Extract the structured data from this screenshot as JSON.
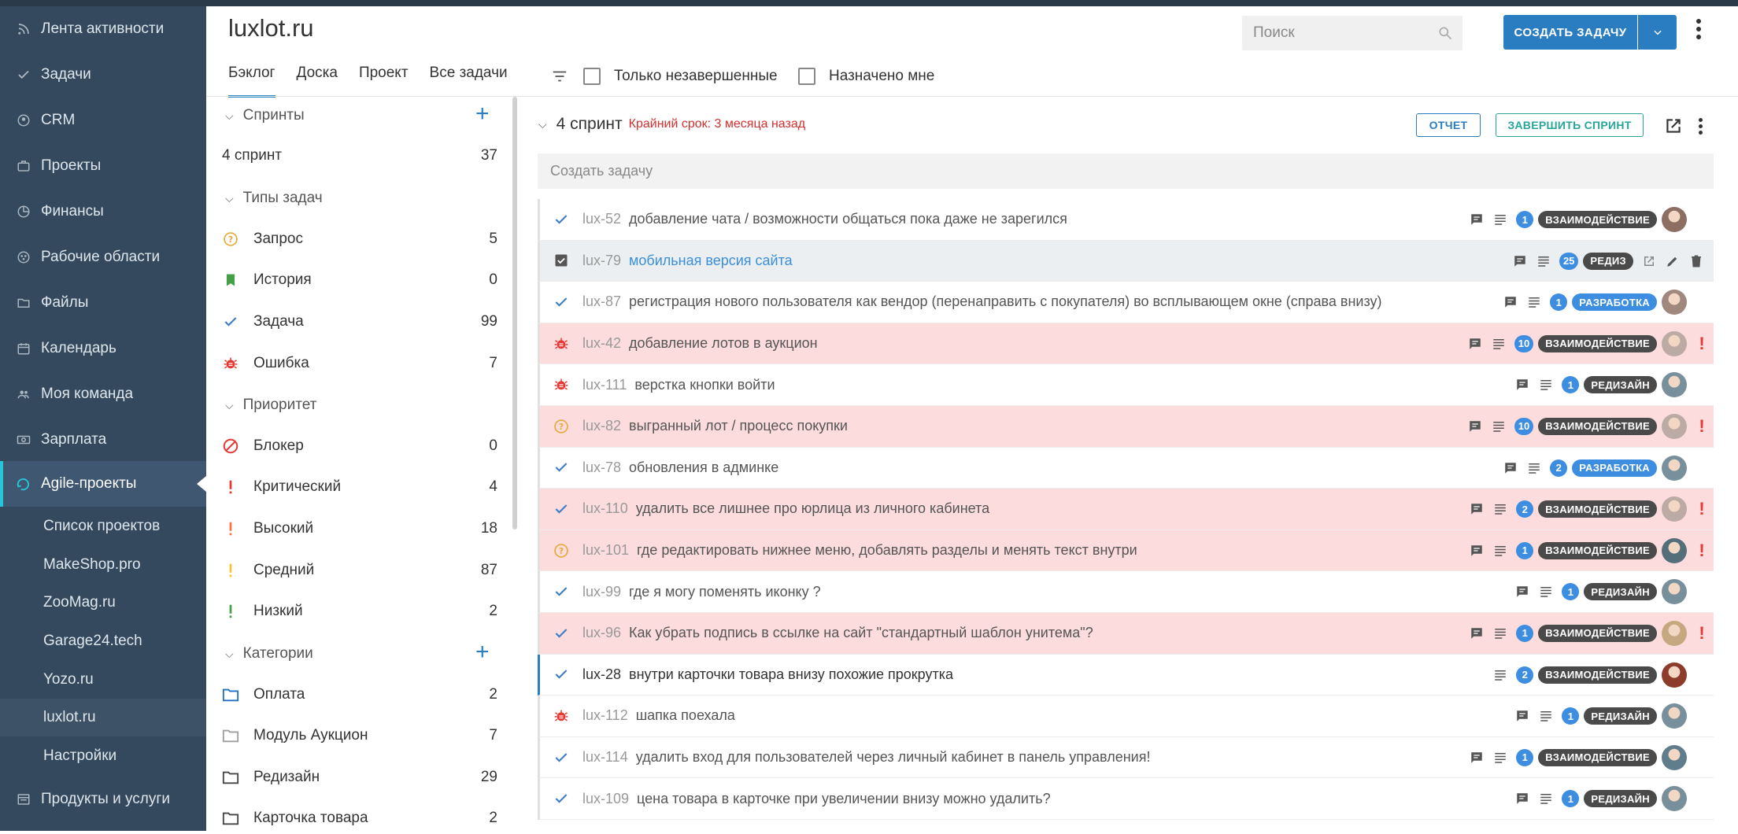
{
  "sidebar": {
    "items": [
      {
        "label": "Лента активности",
        "icon": "rss-icon"
      },
      {
        "label": "Задачи",
        "icon": "check-icon"
      },
      {
        "label": "CRM",
        "icon": "person-circle-icon"
      },
      {
        "label": "Проекты",
        "icon": "briefcase-icon"
      },
      {
        "label": "Финансы",
        "icon": "pie-chart-icon"
      },
      {
        "label": "Рабочие области",
        "icon": "workspace-icon"
      },
      {
        "label": "Файлы",
        "icon": "folder-icon"
      },
      {
        "label": "Календарь",
        "icon": "calendar-icon"
      },
      {
        "label": "Моя команда",
        "icon": "team-icon"
      },
      {
        "label": "Зарплата",
        "icon": "money-icon"
      },
      {
        "label": "Agile-проекты",
        "icon": "agile-icon"
      }
    ],
    "subitems": [
      "Список проектов",
      "MakeShop.pro",
      "ZooMag.ru",
      "Garage24.tech",
      "Yozo.ru",
      "luxlot.ru",
      "Настройки"
    ],
    "bottom": {
      "label": "Продукты и услуги",
      "icon": "products-icon"
    }
  },
  "header": {
    "title": "luxlot.ru",
    "tabs": [
      "Бэклог",
      "Доска",
      "Проект",
      "Все задачи"
    ],
    "filter_unfinished": "Только незавершенные",
    "filter_assigned": "Назначено мне",
    "search_placeholder": "Поиск",
    "create_button": "СОЗДАТЬ ЗАДАЧУ"
  },
  "filters": {
    "sprints_title": "Спринты",
    "sprint_item": {
      "label": "4 спринт",
      "count": "37"
    },
    "types_title": "Типы задач",
    "types": [
      {
        "label": "Запрос",
        "count": "5",
        "icon": "question-icon"
      },
      {
        "label": "История",
        "count": "0",
        "icon": "bookmark-icon"
      },
      {
        "label": "Задача",
        "count": "99",
        "icon": "check-icon"
      },
      {
        "label": "Ошибка",
        "count": "7",
        "icon": "bug-icon"
      }
    ],
    "priority_title": "Приоритет",
    "priorities": [
      {
        "label": "Блокер",
        "count": "0",
        "icon": "blocker-icon"
      },
      {
        "label": "Критический",
        "count": "4",
        "icon": "exclamation-red-icon"
      },
      {
        "label": "Высокий",
        "count": "18",
        "icon": "exclamation-orange-icon"
      },
      {
        "label": "Средний",
        "count": "87",
        "icon": "exclamation-yellow-icon"
      },
      {
        "label": "Низкий",
        "count": "2",
        "icon": "exclamation-green-icon"
      }
    ],
    "categories_title": "Категории",
    "categories": [
      {
        "label": "Оплата",
        "count": "2",
        "color": "#1e6fc2"
      },
      {
        "label": "Модуль Аукцион",
        "count": "7",
        "color": "#9e9e9e"
      },
      {
        "label": "Редизайн",
        "count": "29",
        "color": "#444444"
      },
      {
        "label": "Карточка товара",
        "count": "2",
        "color": "#444444"
      }
    ]
  },
  "sprint": {
    "name": "4 спринт",
    "deadline": "Крайний срок: 3 месяца назад",
    "report_button": "ОТЧЕТ",
    "finish_button": "ЗАВЕРШИТЬ СПРИНТ",
    "create_placeholder": "Создать задачу"
  },
  "tasks": [
    {
      "key": "lux-52",
      "title": "добавление чата / возможности общаться пока даже не зарегился",
      "type": "task",
      "bg": "normal",
      "comment": true,
      "count": "1",
      "tag": "ВЗАИМОДЕЙСТВИЕ",
      "tag_style": "dark",
      "avatar": "#8d6e63",
      "flag": false
    },
    {
      "key": "lux-79",
      "title": "мобильная версия сайта",
      "type": "checkbox",
      "bg": "selected",
      "comment": true,
      "count": "25",
      "tag": "РЕДИЗ",
      "tag_style": "dark",
      "avatar": "",
      "flag": false,
      "actions": true
    },
    {
      "key": "lux-87",
      "title": "регистрация нового пользователя как вендор (перенаправить с покупателя) во всплывающем окне (справа внизу)",
      "type": "task",
      "bg": "normal",
      "comment": true,
      "count": "1",
      "tag": "РАЗРАБОТКА",
      "tag_style": "blue",
      "avatar": "#a1887f",
      "flag": false
    },
    {
      "key": "lux-42",
      "title": "добавление лотов в аукцион",
      "type": "bug",
      "bg": "red",
      "comment": true,
      "count": "10",
      "tag": "ВЗАИМОДЕЙСТВИЕ",
      "tag_style": "dark",
      "avatar": "#bcaaa4",
      "flag": true
    },
    {
      "key": "lux-111",
      "title": "верстка кнопки войти",
      "type": "bug",
      "bg": "normal",
      "comment": true,
      "count": "1",
      "tag": "РЕДИЗАЙН",
      "tag_style": "dark",
      "avatar": "#78909c",
      "flag": false
    },
    {
      "key": "lux-82",
      "title": "выгранный лот / процесс покупки",
      "type": "question",
      "bg": "red",
      "comment": true,
      "count": "10",
      "tag": "ВЗАИМОДЕЙСТВИЕ",
      "tag_style": "dark",
      "avatar": "#bcaaa4",
      "flag": true
    },
    {
      "key": "lux-78",
      "title": "обновления в админке",
      "type": "task",
      "bg": "normal",
      "comment": true,
      "count": "2",
      "tag": "РАЗРАБОТКА",
      "tag_style": "blue",
      "avatar": "#78909c",
      "flag": false
    },
    {
      "key": "lux-110",
      "title": "удалить все лишнее про юрлица из личного кабинета",
      "type": "task",
      "bg": "red",
      "comment": true,
      "count": "2",
      "tag": "ВЗАИМОДЕЙСТВИЕ",
      "tag_style": "dark",
      "avatar": "#bcaaa4",
      "flag": true
    },
    {
      "key": "lux-101",
      "title": "где редактировать нижнее меню, добавлять разделы и менять текст внутри",
      "type": "question",
      "bg": "red",
      "comment": true,
      "count": "1",
      "tag": "ВЗАИМОДЕЙСТВИЕ",
      "tag_style": "dark",
      "avatar": "#546e7a",
      "flag": true
    },
    {
      "key": "lux-99",
      "title": "где я могу поменять иконку ?",
      "type": "task",
      "bg": "normal",
      "comment": true,
      "count": "1",
      "tag": "РЕДИЗАЙН",
      "tag_style": "dark",
      "avatar": "#78909c",
      "flag": false
    },
    {
      "key": "lux-96",
      "title": "Как убрать подпись в ссылке на сайт \"стандартный шаблон унитема\"?",
      "type": "task",
      "bg": "red",
      "comment": true,
      "count": "1",
      "tag": "ВЗАИМОДЕЙСТВИЕ",
      "tag_style": "dark",
      "avatar": "#c5a880",
      "flag": true
    },
    {
      "key": "lux-28",
      "title": "внутри карточки товара внизу похожие прокрутка",
      "type": "task",
      "bg": "dark",
      "comment": false,
      "count": "2",
      "tag": "ВЗАИМОДЕЙСТВИЕ",
      "tag_style": "dark",
      "avatar": "#8d3b2a",
      "flag": false
    },
    {
      "key": "lux-112",
      "title": "шапка поехала",
      "type": "bug",
      "bg": "normal",
      "comment": true,
      "count": "1",
      "tag": "РЕДИЗАЙН",
      "tag_style": "dark",
      "avatar": "#78909c",
      "flag": false
    },
    {
      "key": "lux-114",
      "title": "удалить вход для пользователей через личный кабинет в панель управления!",
      "type": "task",
      "bg": "normal",
      "comment": true,
      "count": "1",
      "tag": "ВЗАИМОДЕЙСТВИЕ",
      "tag_style": "dark",
      "avatar": "#607d8b",
      "flag": false
    },
    {
      "key": "lux-109",
      "title": "цена товара в карточке при увеличении внизу можно удалить?",
      "type": "task",
      "bg": "normal",
      "comment": true,
      "count": "1",
      "tag": "РЕДИЗАЙН",
      "tag_style": "dark",
      "avatar": "#78909c",
      "flag": false
    }
  ]
}
